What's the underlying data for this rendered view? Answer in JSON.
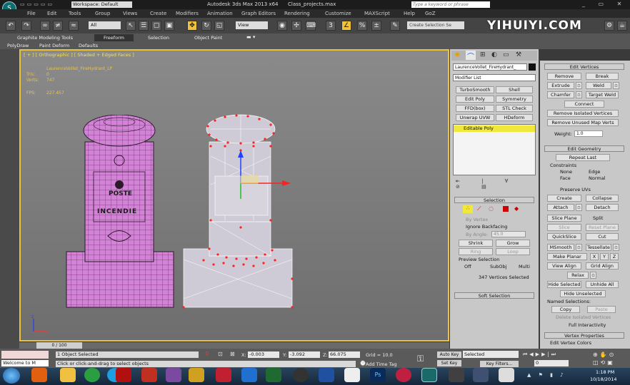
{
  "titlebar": {
    "workspace": "Workspace: Default",
    "app_title": "Autodesk 3ds Max 2013 x64",
    "file": "Class_projects.max",
    "search_placeholder": "Type a keyword or phrase",
    "watermark": "YIHUIYI.COM"
  },
  "menu": [
    "File",
    "Edit",
    "Tools",
    "Group",
    "Views",
    "Create",
    "Modifiers",
    "Animation",
    "Graph Editors",
    "Rendering",
    "Customize",
    "MAXScript",
    "Help",
    "GoZ"
  ],
  "toolbar": {
    "filter": "All",
    "view": "View",
    "selection_set": "Create Selection Se"
  },
  "ribbon_tabs": [
    "Graphite Modeling Tools",
    "Freeform",
    "Selection",
    "Object Paint"
  ],
  "ribbon_sub": [
    "PolyDraw",
    "Paint Deform",
    "Defaults"
  ],
  "viewport": {
    "label": "[ + ] [ Orthographic ] [ Shaded + Edged Faces ]",
    "object": "LaurenceVollet_FireHydrant_LP",
    "stats": [
      {
        "k": "Tris:",
        "v": "0"
      },
      {
        "k": "Verts:",
        "v": "747"
      }
    ],
    "fps_label": "FPS:",
    "fps": "227.457",
    "hydrant_text1": "POSTE",
    "hydrant_text2": "INCENDIE",
    "timeline": "0 / 100"
  },
  "command_panel": {
    "object_name": "LaurenceVollet_FireHydrant_",
    "modifier_list": "Modifier List",
    "modifier_buttons": [
      "TurboSmooth",
      "Shell",
      "Edit Poly",
      "Symmetry",
      "FFD(box)",
      "STL Check",
      "Unwrap UVW",
      "HDeform (WSM)"
    ],
    "stack_item": "Editable Poly",
    "selection_title": "Selection",
    "by_vertex": "By Vertex",
    "ignore_backfacing": "Ignore Backfacing",
    "by_angle": "By Angle:",
    "angle_value": "45.0",
    "shrink": "Shrink",
    "grow": "Grow",
    "ring": "Ring",
    "loop": "Loop",
    "preview_title": "Preview Selection",
    "preview_opts": [
      "Off",
      "SubObj",
      "Multi"
    ],
    "status": "347 Vertices Selected",
    "soft_selection": "Soft Selection"
  },
  "edit_panel": {
    "edit_vertices": "Edit Vertices",
    "remove": "Remove",
    "break": "Break",
    "extrude": "Extrude",
    "weld": "Weld",
    "chamfer": "Chamfer",
    "target_weld": "Target Weld",
    "connect": "Connect",
    "remove_isolated": "Remove Isolated Vertices",
    "remove_unused": "Remove Unused Map Verts",
    "weight_label": "Weight:",
    "weight_value": "1.0",
    "edit_geometry": "Edit Geometry",
    "repeat_last": "Repeat Last",
    "constraints": "Constraints",
    "c_none": "None",
    "c_edge": "Edge",
    "c_face": "Face",
    "c_normal": "Normal",
    "preserve_uvs": "Preserve UVs",
    "create": "Create",
    "collapse": "Collapse",
    "attach": "Attach",
    "detach": "Detach",
    "slice_plane": "Slice Plane",
    "split": "Split",
    "slice": "Slice",
    "reset_plane": "Reset Plane",
    "quickslice": "QuickSlice",
    "cut": "Cut",
    "msmooth": "MSmooth",
    "tessellate": "Tessellate",
    "make_planar": "Make Planar",
    "x": "X",
    "y": "Y",
    "z": "Z",
    "view_align": "View Align",
    "grid_align": "Grid Align",
    "relax": "Relax",
    "hide_selected": "Hide Selected",
    "unhide_all": "Unhide All",
    "hide_unselected": "Hide Unselected",
    "named_selections": "Named Selections:",
    "copy": "Copy",
    "paste": "Paste",
    "delete_isolated": "Delete Isolated Vertices",
    "full_interactivity": "Full Interactivity",
    "vertex_properties": "Vertex Properties",
    "edit_vertex_colors": "Edit Vertex Colors"
  },
  "statusbar": {
    "welcome": "Welcome to M",
    "selected": "1 Object Selected",
    "prompt": "Click or click-and-drag to select objects",
    "x": "-0.003",
    "y": "-3.092",
    "z": "66.075",
    "grid": "Grid = 10.0",
    "add_time_tag": "Add Time Tag",
    "auto_key": "Auto Key",
    "set_key": "Set Key",
    "key_mode": "Selected",
    "key_filters": "Key Filters...",
    "frame": "0"
  },
  "taskbar": {
    "time": "1:18 PM",
    "date": "10/18/2014"
  }
}
